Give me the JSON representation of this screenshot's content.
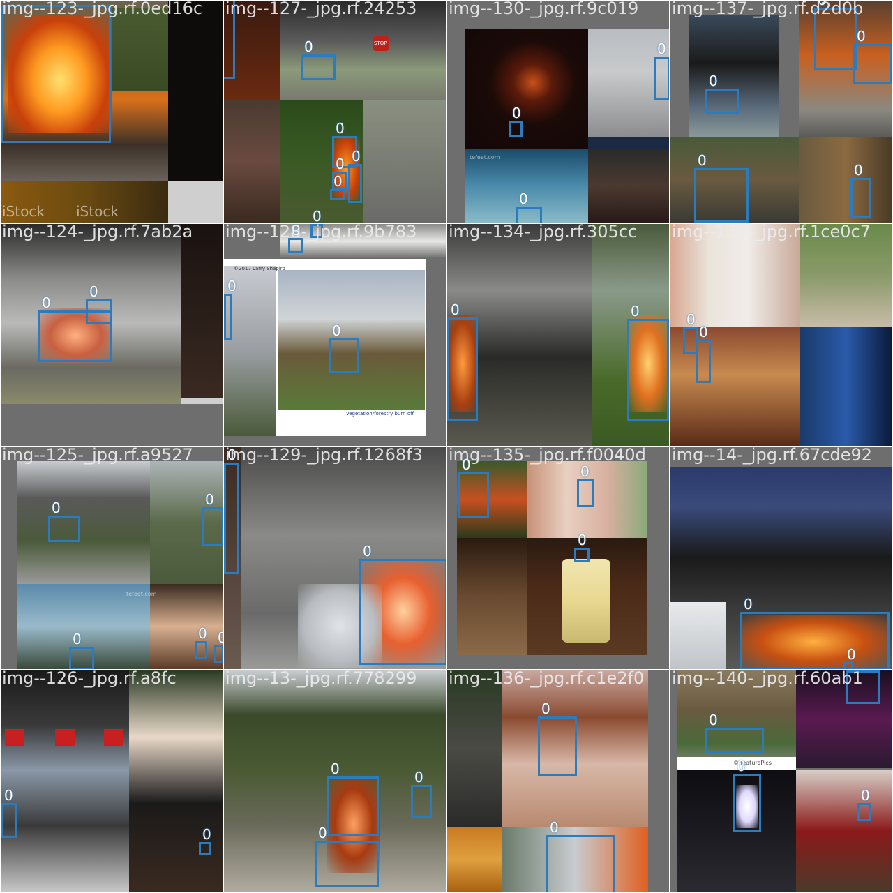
{
  "tiles": [
    {
      "label": "img--123-_jpg.rf.0ed16c"
    },
    {
      "label": "img--127-_jpg.rf.24253"
    },
    {
      "label": "img--130-_jpg.rf.9c019"
    },
    {
      "label": "img--137-_jpg.rf.d2d0b"
    },
    {
      "label": "img--124-_jpg.rf.7ab2a"
    },
    {
      "label": "img--128-_jpg.rf.9b783"
    },
    {
      "label": "img--134-_jpg.rf.305cc"
    },
    {
      "label": "img--138-_jpg.rf.1ce0c7"
    },
    {
      "label": "img--125-_jpg.rf.a9527"
    },
    {
      "label": "img--129-_jpg.rf.1268f3"
    },
    {
      "label": "img--135-_jpg.rf.f0040d"
    },
    {
      "label": "img--14-_jpg.rf.67cde92"
    },
    {
      "label": "img--126-_jpg.rf.a8fc"
    },
    {
      "label": "img--13-_jpg.rf.778299"
    },
    {
      "label": "img--136-_jpg.rf.c1e2f0"
    },
    {
      "label": "img--140-_jpg.rf.60ab1"
    }
  ],
  "box_class": "0",
  "box_color": "#2b7bbf",
  "watermarks": {
    "istock_1": "iStock",
    "istock_2": "iStock",
    "stop": "STOP",
    "tefeet_1": "tefeet.com",
    "tefeet_2": "tefeet.com",
    "vegetation": "Vegetation/forestry burn off",
    "copyright": "©2017 Larry Shapiro",
    "featurepics": "© featurePics"
  }
}
